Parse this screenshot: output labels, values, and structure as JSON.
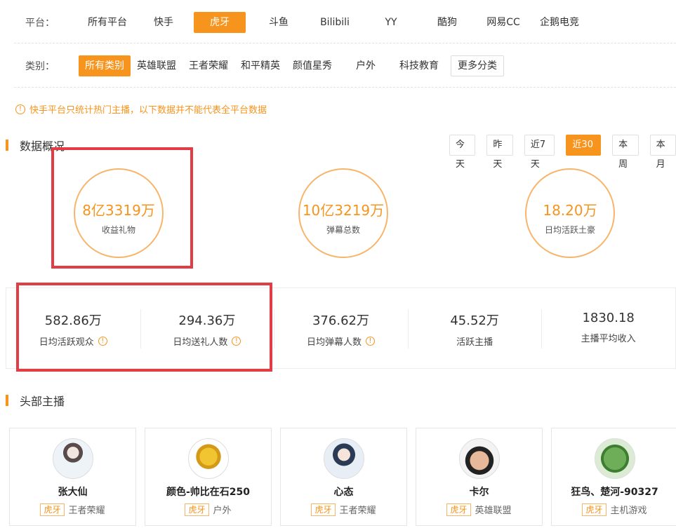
{
  "filters": {
    "platform_label": "平台：",
    "platforms": [
      "所有平台",
      "快手",
      "虎牙",
      "斗鱼",
      "Bilibili",
      "YY",
      "酷狗",
      "网易CC",
      "企鹅电竞"
    ],
    "platform_active": "虎牙",
    "category_label": "类别：",
    "categories": [
      "所有类别",
      "英雄联盟",
      "王者荣耀",
      "和平精英",
      "颜值星秀",
      "户外",
      "科技教育"
    ],
    "category_active": "所有类别",
    "more_categories": "更多分类"
  },
  "notice": {
    "icon": "!",
    "text": "快手平台只统计热门主播，以下数据并不能代表全平台数据"
  },
  "overview": {
    "title": "数据概况",
    "ranges": [
      "今天",
      "昨天",
      "近7天",
      "近30天",
      "本周",
      "本月"
    ],
    "range_active": "近30天",
    "circles": [
      {
        "value": "8亿3319万",
        "label": "收益礼物"
      },
      {
        "value": "10亿3219万",
        "label": "弹幕总数"
      },
      {
        "value": "18.20万",
        "label": "日均活跃土豪"
      }
    ],
    "stats": [
      {
        "value": "582.86万",
        "label": "日均活跃观众",
        "info_icon": "!"
      },
      {
        "value": "294.36万",
        "label": "日均送礼人数",
        "info_icon": "!"
      },
      {
        "value": "376.62万",
        "label": "日均弹幕人数",
        "info_icon": "!"
      },
      {
        "value": "45.52万",
        "label": "活跃主播"
      },
      {
        "value": "1830.18",
        "label": "主播平均收入"
      }
    ]
  },
  "top_streamers": {
    "title": "头部主播",
    "cards": [
      {
        "name": "张大仙",
        "platform": "虎牙",
        "category": "王者荣耀"
      },
      {
        "name": "颜色-帅比在石250",
        "platform": "虎牙",
        "category": "户外"
      },
      {
        "name": "心态",
        "platform": "虎牙",
        "category": "王者荣耀"
      },
      {
        "name": "卡尔",
        "platform": "虎牙",
        "category": "英雄联盟"
      },
      {
        "name": "狂鸟、楚河-90327",
        "platform": "虎牙",
        "category": "主机游戏"
      }
    ]
  },
  "colors": {
    "accent": "#f7941d",
    "highlight_box": "#e23c45"
  }
}
